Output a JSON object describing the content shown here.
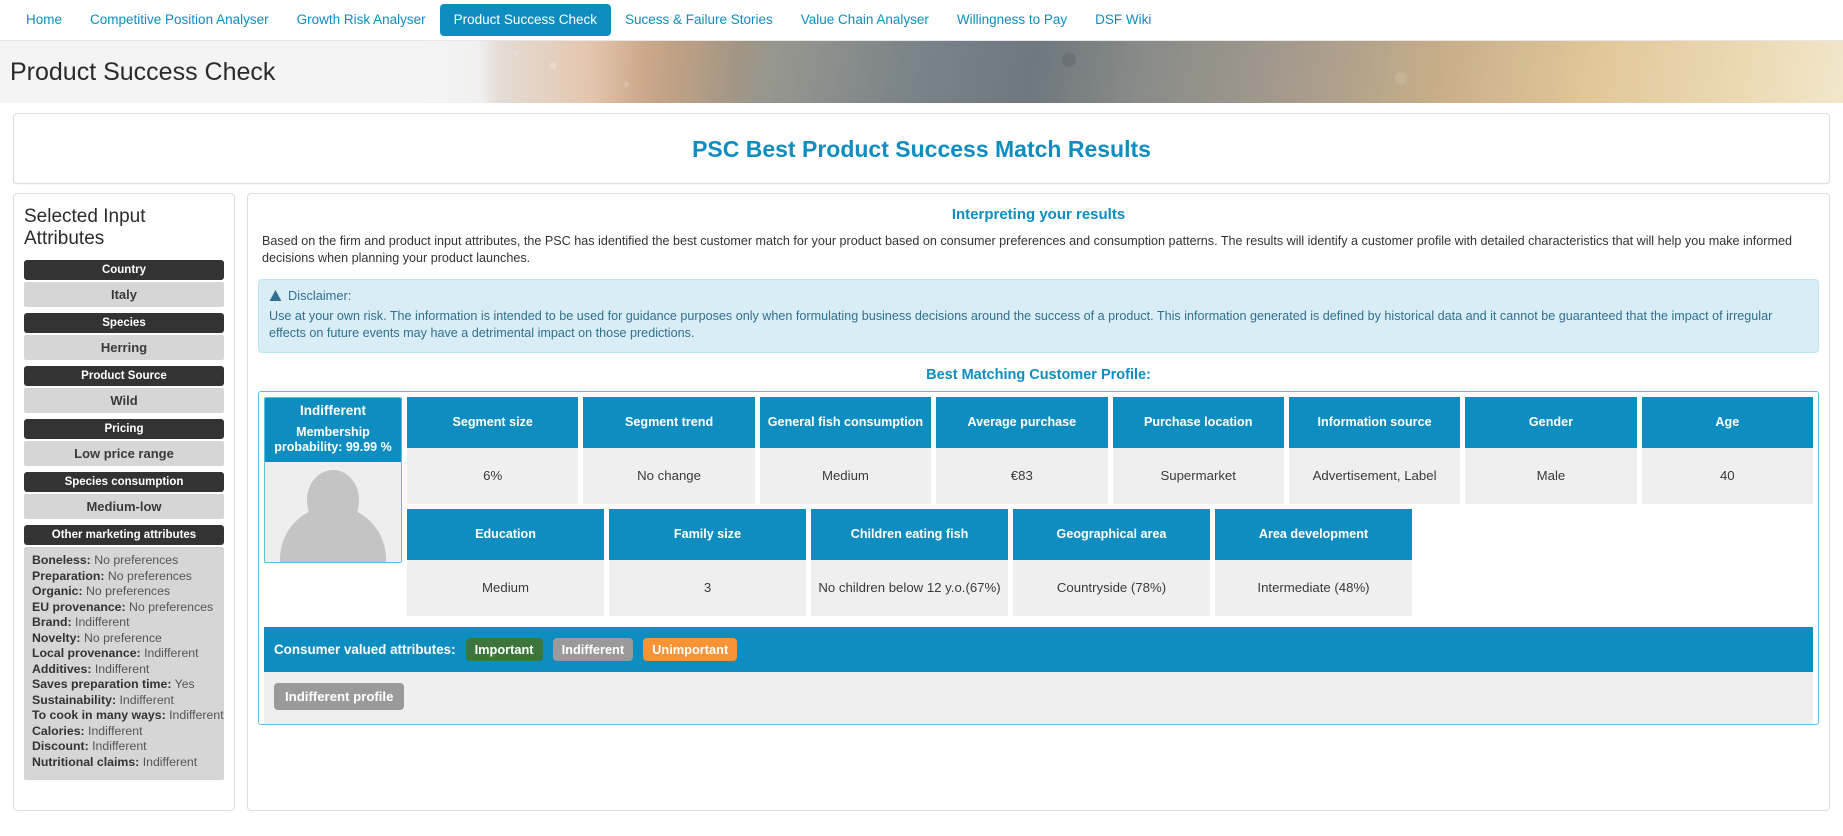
{
  "nav": {
    "items": [
      {
        "label": "Home",
        "active": false
      },
      {
        "label": "Competitive Position Analyser",
        "active": false
      },
      {
        "label": "Growth Risk Analyser",
        "active": false
      },
      {
        "label": "Product Success Check",
        "active": true
      },
      {
        "label": "Sucess & Failure Stories",
        "active": false
      },
      {
        "label": "Value Chain Analyser",
        "active": false
      },
      {
        "label": "Willingness to Pay",
        "active": false
      },
      {
        "label": "DSF Wiki",
        "active": false
      }
    ]
  },
  "banner": {
    "title": "Product Success Check"
  },
  "page": {
    "results_title": "PSC Best Product Success Match Results"
  },
  "sidebar": {
    "title": "Selected Input Attributes",
    "attributes": [
      {
        "label": "Country",
        "value": "Italy"
      },
      {
        "label": "Species",
        "value": "Herring"
      },
      {
        "label": "Product Source",
        "value": "Wild"
      },
      {
        "label": "Pricing",
        "value": "Low price range"
      },
      {
        "label": "Species consumption",
        "value": "Medium-low"
      }
    ],
    "other_header": "Other marketing attributes",
    "other": [
      {
        "label": "Boneless:",
        "value": "No preferences"
      },
      {
        "label": "Preparation:",
        "value": "No preferences"
      },
      {
        "label": "Organic:",
        "value": "No preferences"
      },
      {
        "label": "EU provenance:",
        "value": "No preferences"
      },
      {
        "label": "Brand:",
        "value": "Indifferent"
      },
      {
        "label": "Novelty:",
        "value": "No preference"
      },
      {
        "label": "Local provenance:",
        "value": "Indifferent"
      },
      {
        "label": "Additives:",
        "value": "Indifferent"
      },
      {
        "label": "Saves preparation time:",
        "value": "Yes"
      },
      {
        "label": "Sustainability:",
        "value": "Indifferent"
      },
      {
        "label": "To cook in many ways:",
        "value": "Indifferent"
      },
      {
        "label": "Calories:",
        "value": "Indifferent"
      },
      {
        "label": "Discount:",
        "value": "Indifferent"
      },
      {
        "label": "Nutritional claims:",
        "value": "Indifferent"
      }
    ]
  },
  "main": {
    "interpreting_title": "Interpreting your results",
    "interpreting_text": "Based on the firm and product input attributes, the PSC has identified the best customer match for your product based on consumer preferences and consumption patterns. The results will identify a customer profile with detailed characteristics that will help you make informed decisions when planning your product launches.",
    "disclaimer_title": "Disclaimer:",
    "disclaimer_text": "Use at your own risk. The information is intended to be used for guidance purposes only when formulating business decisions around the success of a product. This information generated is defined by historical data and it cannot be guaranteed that the impact of irregular effects on future events may have a detrimental impact on those predictions.",
    "best_match_title": "Best Matching Customer Profile:"
  },
  "profile": {
    "segment_name": "Indifferent",
    "membership_text": "Membership probability: 99.99 %",
    "row1": [
      {
        "header": "Segment size",
        "value": "6%"
      },
      {
        "header": "Segment trend",
        "value": "No change"
      },
      {
        "header": "General fish consumption",
        "value": "Medium"
      },
      {
        "header": "Average purchase",
        "value": "€83"
      },
      {
        "header": "Purchase location",
        "value": "Supermarket"
      },
      {
        "header": "Information source",
        "value": "Advertisement, Label"
      },
      {
        "header": "Gender",
        "value": "Male"
      },
      {
        "header": "Age",
        "value": "40"
      }
    ],
    "row2": [
      {
        "header": "Education",
        "value": "Medium"
      },
      {
        "header": "Family size",
        "value": "3"
      },
      {
        "header": "Children eating fish",
        "value": "No children below 12 y.o.(67%)"
      },
      {
        "header": "Geographical area",
        "value": "Countryside (78%)"
      },
      {
        "header": "Area development",
        "value": "Intermediate (48%)"
      }
    ]
  },
  "consumer_valued": {
    "label": "Consumer valued attributes:",
    "badges": [
      {
        "text": "Important",
        "color": "#3c763d"
      },
      {
        "text": "Indifferent",
        "color": "#9a9a9a"
      },
      {
        "text": "Unimportant",
        "color": "#f89435"
      }
    ],
    "profile_button": "Indifferent profile"
  },
  "colors": {
    "accent": "#0d8dc0",
    "dark_head": "#333333",
    "value_gray": "#d6d6d6",
    "cell_gray": "#efefef",
    "disclaimer_bg": "#d9edf7",
    "disclaimer_text": "#31708f"
  }
}
